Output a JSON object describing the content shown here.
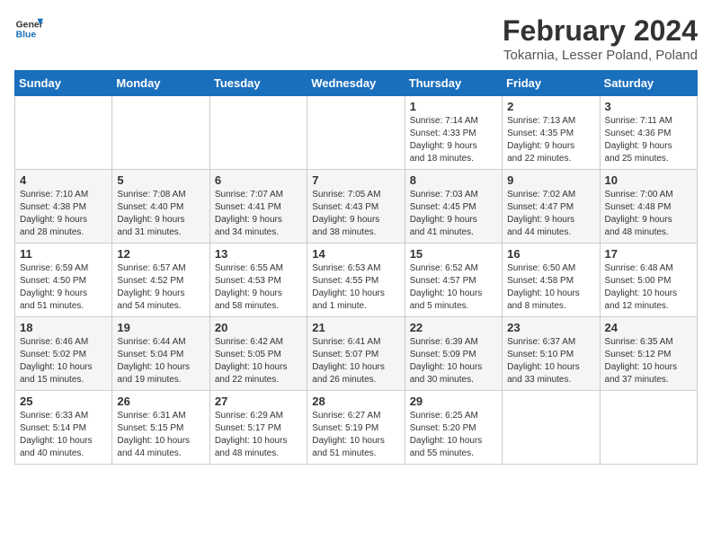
{
  "header": {
    "logo_line1": "General",
    "logo_line2": "Blue",
    "month_year": "February 2024",
    "location": "Tokarnia, Lesser Poland, Poland"
  },
  "weekdays": [
    "Sunday",
    "Monday",
    "Tuesday",
    "Wednesday",
    "Thursday",
    "Friday",
    "Saturday"
  ],
  "weeks": [
    [
      {
        "day": "",
        "info": ""
      },
      {
        "day": "",
        "info": ""
      },
      {
        "day": "",
        "info": ""
      },
      {
        "day": "",
        "info": ""
      },
      {
        "day": "1",
        "info": "Sunrise: 7:14 AM\nSunset: 4:33 PM\nDaylight: 9 hours\nand 18 minutes."
      },
      {
        "day": "2",
        "info": "Sunrise: 7:13 AM\nSunset: 4:35 PM\nDaylight: 9 hours\nand 22 minutes."
      },
      {
        "day": "3",
        "info": "Sunrise: 7:11 AM\nSunset: 4:36 PM\nDaylight: 9 hours\nand 25 minutes."
      }
    ],
    [
      {
        "day": "4",
        "info": "Sunrise: 7:10 AM\nSunset: 4:38 PM\nDaylight: 9 hours\nand 28 minutes."
      },
      {
        "day": "5",
        "info": "Sunrise: 7:08 AM\nSunset: 4:40 PM\nDaylight: 9 hours\nand 31 minutes."
      },
      {
        "day": "6",
        "info": "Sunrise: 7:07 AM\nSunset: 4:41 PM\nDaylight: 9 hours\nand 34 minutes."
      },
      {
        "day": "7",
        "info": "Sunrise: 7:05 AM\nSunset: 4:43 PM\nDaylight: 9 hours\nand 38 minutes."
      },
      {
        "day": "8",
        "info": "Sunrise: 7:03 AM\nSunset: 4:45 PM\nDaylight: 9 hours\nand 41 minutes."
      },
      {
        "day": "9",
        "info": "Sunrise: 7:02 AM\nSunset: 4:47 PM\nDaylight: 9 hours\nand 44 minutes."
      },
      {
        "day": "10",
        "info": "Sunrise: 7:00 AM\nSunset: 4:48 PM\nDaylight: 9 hours\nand 48 minutes."
      }
    ],
    [
      {
        "day": "11",
        "info": "Sunrise: 6:59 AM\nSunset: 4:50 PM\nDaylight: 9 hours\nand 51 minutes."
      },
      {
        "day": "12",
        "info": "Sunrise: 6:57 AM\nSunset: 4:52 PM\nDaylight: 9 hours\nand 54 minutes."
      },
      {
        "day": "13",
        "info": "Sunrise: 6:55 AM\nSunset: 4:53 PM\nDaylight: 9 hours\nand 58 minutes."
      },
      {
        "day": "14",
        "info": "Sunrise: 6:53 AM\nSunset: 4:55 PM\nDaylight: 10 hours\nand 1 minute."
      },
      {
        "day": "15",
        "info": "Sunrise: 6:52 AM\nSunset: 4:57 PM\nDaylight: 10 hours\nand 5 minutes."
      },
      {
        "day": "16",
        "info": "Sunrise: 6:50 AM\nSunset: 4:58 PM\nDaylight: 10 hours\nand 8 minutes."
      },
      {
        "day": "17",
        "info": "Sunrise: 6:48 AM\nSunset: 5:00 PM\nDaylight: 10 hours\nand 12 minutes."
      }
    ],
    [
      {
        "day": "18",
        "info": "Sunrise: 6:46 AM\nSunset: 5:02 PM\nDaylight: 10 hours\nand 15 minutes."
      },
      {
        "day": "19",
        "info": "Sunrise: 6:44 AM\nSunset: 5:04 PM\nDaylight: 10 hours\nand 19 minutes."
      },
      {
        "day": "20",
        "info": "Sunrise: 6:42 AM\nSunset: 5:05 PM\nDaylight: 10 hours\nand 22 minutes."
      },
      {
        "day": "21",
        "info": "Sunrise: 6:41 AM\nSunset: 5:07 PM\nDaylight: 10 hours\nand 26 minutes."
      },
      {
        "day": "22",
        "info": "Sunrise: 6:39 AM\nSunset: 5:09 PM\nDaylight: 10 hours\nand 30 minutes."
      },
      {
        "day": "23",
        "info": "Sunrise: 6:37 AM\nSunset: 5:10 PM\nDaylight: 10 hours\nand 33 minutes."
      },
      {
        "day": "24",
        "info": "Sunrise: 6:35 AM\nSunset: 5:12 PM\nDaylight: 10 hours\nand 37 minutes."
      }
    ],
    [
      {
        "day": "25",
        "info": "Sunrise: 6:33 AM\nSunset: 5:14 PM\nDaylight: 10 hours\nand 40 minutes."
      },
      {
        "day": "26",
        "info": "Sunrise: 6:31 AM\nSunset: 5:15 PM\nDaylight: 10 hours\nand 44 minutes."
      },
      {
        "day": "27",
        "info": "Sunrise: 6:29 AM\nSunset: 5:17 PM\nDaylight: 10 hours\nand 48 minutes."
      },
      {
        "day": "28",
        "info": "Sunrise: 6:27 AM\nSunset: 5:19 PM\nDaylight: 10 hours\nand 51 minutes."
      },
      {
        "day": "29",
        "info": "Sunrise: 6:25 AM\nSunset: 5:20 PM\nDaylight: 10 hours\nand 55 minutes."
      },
      {
        "day": "",
        "info": ""
      },
      {
        "day": "",
        "info": ""
      }
    ]
  ]
}
